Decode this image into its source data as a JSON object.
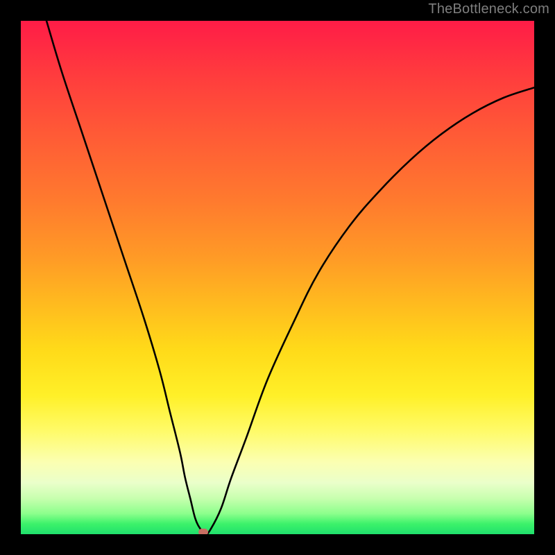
{
  "watermark": "TheBottleneck.com",
  "chart_data": {
    "type": "line",
    "title": "",
    "xlabel": "",
    "ylabel": "",
    "xlim": [
      0,
      100
    ],
    "ylim": [
      0,
      100
    ],
    "grid": false,
    "series": [
      {
        "name": "curve",
        "x": [
          5,
          8,
          12,
          16,
          20,
          24,
          27,
          29,
          31,
          32,
          33,
          34,
          35,
          36,
          37,
          39,
          41,
          44,
          48,
          53,
          58,
          64,
          70,
          76,
          82,
          88,
          94,
          100
        ],
        "y": [
          100,
          90,
          78,
          66,
          54,
          42,
          32,
          24,
          16,
          11,
          7,
          3,
          1,
          0,
          1,
          5,
          11,
          19,
          30,
          41,
          51,
          60,
          67,
          73,
          78,
          82,
          85,
          87
        ]
      }
    ],
    "background_gradient": {
      "top": "#ff1c47",
      "mid": "#ffda19",
      "bottom": "#1fe06c"
    },
    "marker": {
      "x": 35.5,
      "y": 0,
      "color": "#c96f63"
    }
  }
}
